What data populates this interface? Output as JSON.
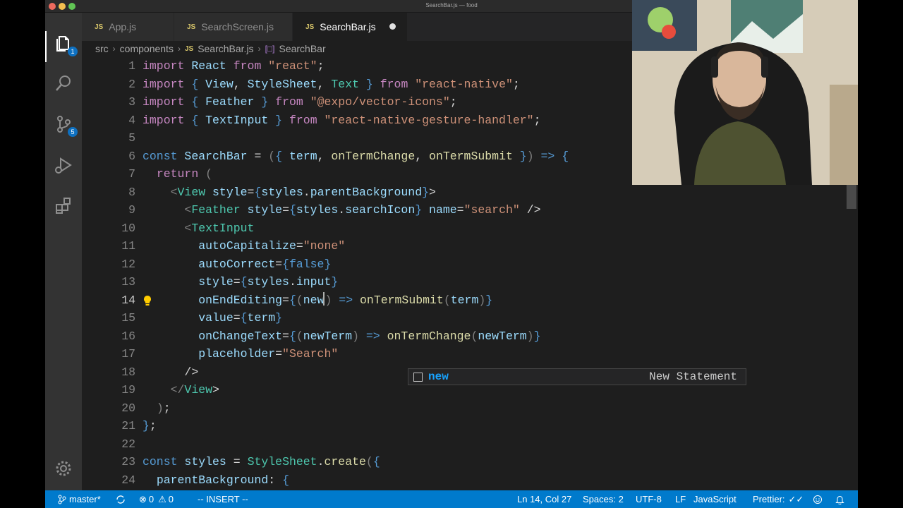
{
  "window": {
    "title": "SearchBar.js — food"
  },
  "activity_bar": {
    "items": [
      {
        "name": "explorer",
        "badge": "1"
      },
      {
        "name": "search"
      },
      {
        "name": "source-control",
        "badge": "5"
      },
      {
        "name": "run-debug"
      },
      {
        "name": "extensions"
      }
    ],
    "manage": "gear"
  },
  "tabs": [
    {
      "label": "App.js",
      "icon": "JS",
      "active": false
    },
    {
      "label": "SearchScreen.js",
      "icon": "JS",
      "active": false
    },
    {
      "label": "SearchBar.js",
      "icon": "JS",
      "active": true,
      "modified": true
    }
  ],
  "breadcrumb": [
    "src",
    "components",
    "SearchBar.js",
    "SearchBar"
  ],
  "editor": {
    "current_line": 14,
    "lines": [
      "import React from \"react\";",
      "import { View, StyleSheet, Text } from \"react-native\";",
      "import { Feather } from \"@expo/vector-icons\";",
      "import { TextInput } from \"react-native-gesture-handler\";",
      "",
      "const SearchBar = ({ term, onTermChange, onTermSubmit }) => {",
      "  return (",
      "    <View style={styles.parentBackground}>",
      "      <Feather style={styles.searchIcon} name=\"search\" />",
      "      <TextInput",
      "        autoCapitalize=\"none\"",
      "        autoCorrect={false}",
      "        style={styles.input}",
      "        onEndEditing={(new) => onTermSubmit(term)}",
      "        value={term}",
      "        onChangeText={(newTerm) => onTermChange(newTerm)}",
      "        placeholder=\"Search\"",
      "      />",
      "    </View>",
      "  );",
      "};",
      "",
      "const styles = StyleSheet.create({",
      "  parentBackground: {"
    ]
  },
  "suggestion": {
    "label": "new",
    "detail": "New Statement"
  },
  "status_bar": {
    "branch": "master*",
    "errors": "0",
    "warnings": "0",
    "mode": "-- INSERT --",
    "position": "Ln 14, Col 27",
    "spaces": "Spaces: 2",
    "encoding": "UTF-8",
    "eol": "LF",
    "language": "JavaScript",
    "formatter": "Prettier:"
  },
  "colors": {
    "status_bar": "#007acc",
    "editor_bg": "#1e1e1e",
    "activity_bar": "#333333"
  }
}
